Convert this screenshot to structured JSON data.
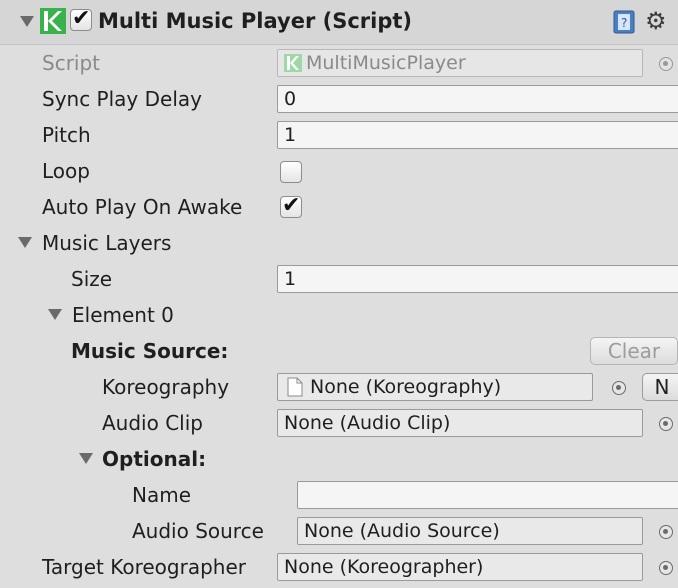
{
  "component": {
    "title": "Multi Music Player (Script)",
    "enabled": true,
    "help_icon": "help-book-icon",
    "settings_icon": "gear-icon"
  },
  "fields": {
    "script_label": "Script",
    "script_value": "MultiMusicPlayer",
    "sync_play_delay_label": "Sync Play Delay",
    "sync_play_delay_value": "0",
    "pitch_label": "Pitch",
    "pitch_value": "1",
    "loop_label": "Loop",
    "loop_checked": false,
    "auto_play_label": "Auto Play On Awake",
    "auto_play_checked": true
  },
  "music_layers": {
    "label": "Music Layers",
    "size_label": "Size",
    "size_value": "1",
    "element_label": "Element 0",
    "music_source_label": "Music Source:",
    "clear_label": "Clear",
    "koreography_label": "Koreography",
    "koreography_value": "None (Koreography)",
    "new_button_label": "N",
    "audio_clip_label": "Audio Clip",
    "audio_clip_value": "None (Audio Clip)",
    "optional_label": "Optional:",
    "name_label": "Name",
    "name_value": "",
    "audio_source_label": "Audio Source",
    "audio_source_value": "None (Audio Source)"
  },
  "target": {
    "label": "Target Koreographer",
    "value": "None (Koreographer)"
  }
}
